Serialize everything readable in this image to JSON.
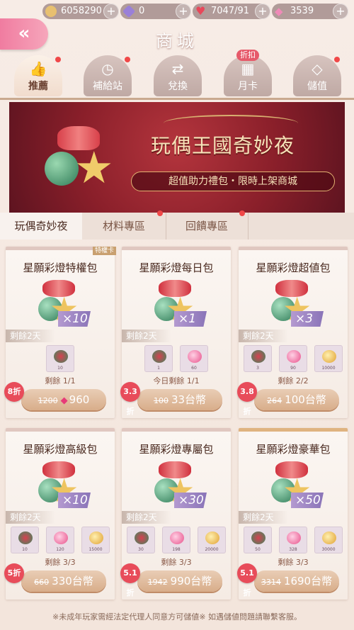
{
  "currencies": [
    {
      "name": "gold",
      "value": "6058290",
      "icon": "gold-coin-icon",
      "color": "#e8c070"
    },
    {
      "name": "crystal",
      "value": "0",
      "icon": "purple-gem-icon",
      "color": "#9a80d8"
    },
    {
      "name": "stamina",
      "value": "7047/91",
      "icon": "heart-icon",
      "color": "#e8485a"
    },
    {
      "name": "diamond",
      "value": "3539",
      "icon": "pink-diamond-icon",
      "color": "#f08ab8"
    }
  ],
  "header": {
    "title": "商城",
    "back_icon": "double-chevron-left-icon"
  },
  "tabs": [
    {
      "label": "推薦",
      "icon": "thumbs-up-icon",
      "active": true
    },
    {
      "label": "補給站",
      "icon": "clock-icon",
      "active": false
    },
    {
      "label": "兌換",
      "icon": "exchange-icon",
      "active": false
    },
    {
      "label": "月卡",
      "icon": "calendar-icon",
      "active": false,
      "badge": "折扣"
    },
    {
      "label": "儲值",
      "icon": "diamond-icon",
      "active": false
    }
  ],
  "banner": {
    "title": "玩偶王國奇妙夜",
    "subtitle": "超值助力禮包・限時上架商城"
  },
  "subtabs": [
    {
      "label": "玩偶奇妙夜",
      "active": true
    },
    {
      "label": "材料專區",
      "active": false
    },
    {
      "label": "回饋專區",
      "active": false
    }
  ],
  "cards": [
    {
      "name": "星願彩燈特權包",
      "corner": "特權卡",
      "qty": "×10",
      "remain": "剩餘2天",
      "items": [
        {
          "n": "10"
        }
      ],
      "limit": "剩餘 1/1",
      "discount": "8折",
      "orig": "1200",
      "price": "960",
      "gem_price": true
    },
    {
      "name": "星願彩燈每日包",
      "qty": "×1",
      "remain": "剩餘2天",
      "items": [
        {
          "n": "1"
        },
        {
          "n": "60"
        }
      ],
      "limit": "今日剩餘 1/1",
      "discount": "3.3折",
      "orig": "100",
      "price": "33台幣",
      "gem_price": false
    },
    {
      "name": "星願彩燈超値包",
      "qty": "×3",
      "remain": "剩餘2天",
      "items": [
        {
          "n": "3"
        },
        {
          "n": "90"
        },
        {
          "n": "10000"
        }
      ],
      "limit": "剩餘 2/2",
      "discount": "3.8折",
      "orig": "264",
      "price": "100台幣",
      "gem_price": false
    },
    {
      "name": "星願彩燈高級包",
      "qty": "×10",
      "remain": "剩餘2天",
      "items": [
        {
          "n": "10"
        },
        {
          "n": "120"
        },
        {
          "n": "15000"
        }
      ],
      "limit": "剩餘 3/3",
      "discount": "5折",
      "orig": "660",
      "price": "330台幣",
      "gem_price": false
    },
    {
      "name": "星願彩燈專屬包",
      "qty": "×30",
      "remain": "剩餘2天",
      "items": [
        {
          "n": "30"
        },
        {
          "n": "198"
        },
        {
          "n": "20000"
        }
      ],
      "limit": "剩餘 3/3",
      "discount": "5.1折",
      "orig": "1942",
      "price": "990台幣",
      "gem_price": false
    },
    {
      "name": "星願彩燈豪華包",
      "qty": "×50",
      "remain": "剩餘2天",
      "items": [
        {
          "n": "50"
        },
        {
          "n": "328"
        },
        {
          "n": "30000"
        }
      ],
      "limit": "剩餘 3/3",
      "discount": "5.1折",
      "orig": "3314",
      "price": "1690台幣",
      "gem_price": false
    }
  ],
  "footer": "※未成年玩家需經法定代理人同意方可儲値※ 如遇儲値問題請聯繫客服。"
}
